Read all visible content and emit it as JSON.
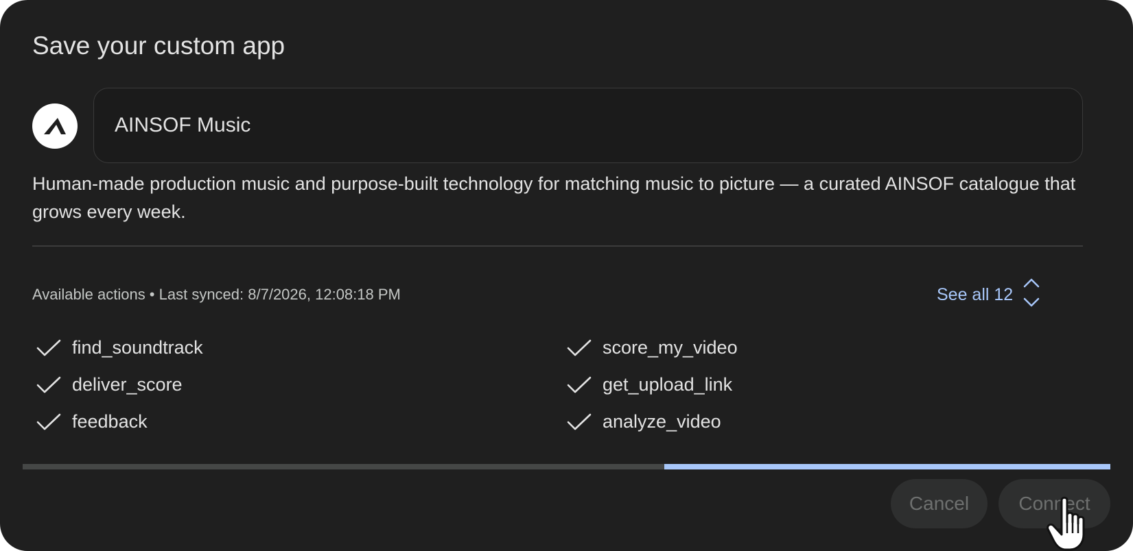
{
  "dialog": {
    "title": "Save your custom app",
    "app_name": "AINSOF Music",
    "app_icon": "ainsof-logo-icon",
    "description": "Human-made production music and purpose-built technology for matching music to picture — a curated AINSOF catalogue that grows every week.",
    "actions_meta": "Available actions • Last synced: 8/7/2026, 12:08:18 PM",
    "see_all_label": "See all 12",
    "actions_left": [
      "find_soundtrack",
      "deliver_score",
      "feedback"
    ],
    "actions_right": [
      "score_my_video",
      "get_upload_link",
      "analyze_video"
    ],
    "progress": 0.41,
    "cancel_label": "Cancel",
    "connect_label": "Connect"
  },
  "colors": {
    "background": "#1f1f1f",
    "accent": "#a8c7fa",
    "text": "#e3e3e3",
    "muted_text": "#c4c7c5",
    "button_disabled_bg": "#2e2f2f",
    "button_disabled_text": "#6e706f"
  },
  "icons": [
    "ainsof-logo-icon",
    "unfold-icon",
    "check-icon",
    "hand-pointer-cursor-icon"
  ]
}
